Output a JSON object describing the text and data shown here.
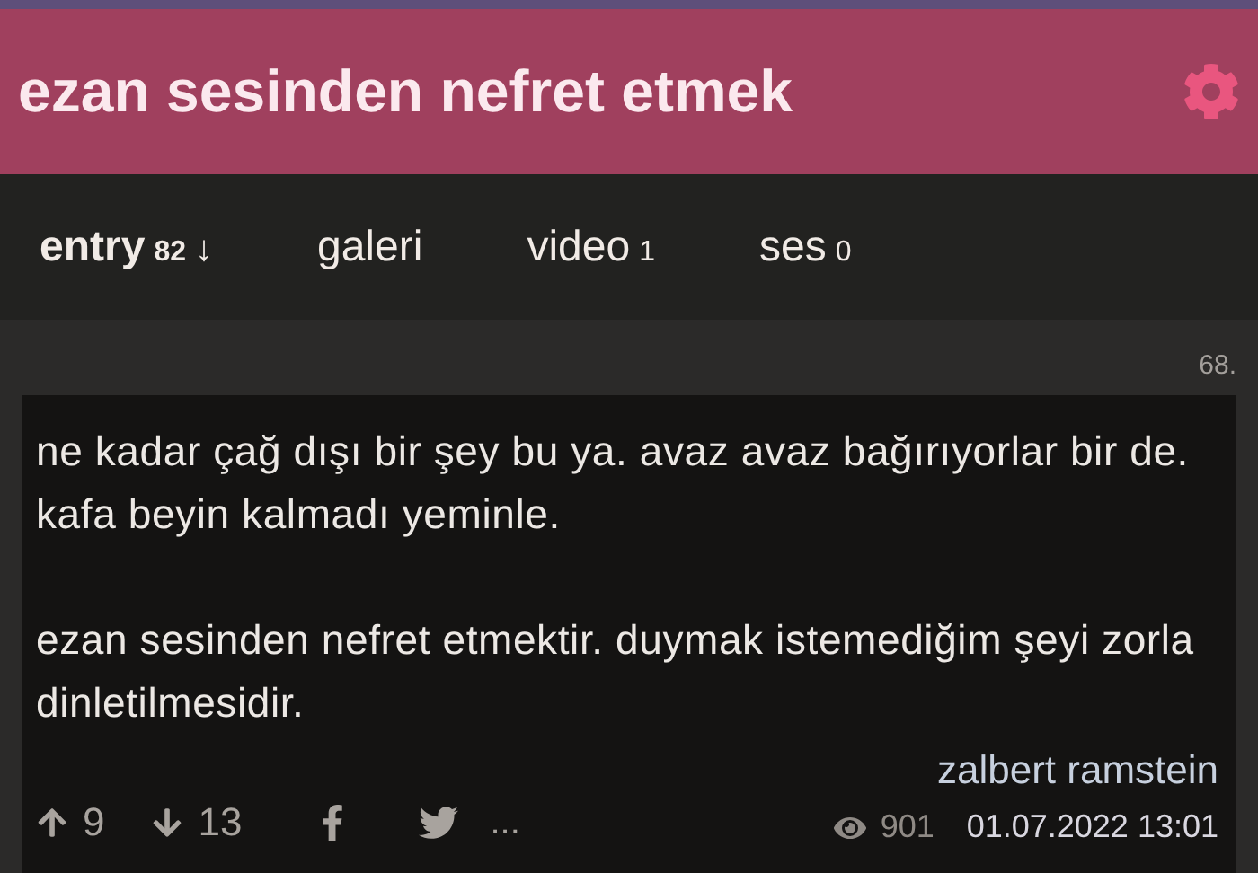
{
  "header": {
    "title": "ezan sesinden nefret etmek"
  },
  "tabs": [
    {
      "label": "entry",
      "count": "82",
      "sort_arrow": "↓",
      "selected": true
    },
    {
      "label": "galeri",
      "selected": false
    },
    {
      "label": "video",
      "count": "1",
      "selected": false
    },
    {
      "label": "ses",
      "count": "0",
      "selected": false
    }
  ],
  "entry": {
    "number": "68.",
    "paragraphs": [
      "ne kadar çağ dışı bir şey bu ya. avaz avaz bağırıyorlar bir de. kafa beyin kalmadı yeminle.",
      "ezan sesinden nefret etmektir. duymak istemediğim şeyi zorla dinletilmesidir."
    ],
    "upvotes": "9",
    "downvotes": "13",
    "more": "...",
    "author": "zalbert ramstein",
    "views": "901",
    "date": "01.07.2022 13:01"
  }
}
